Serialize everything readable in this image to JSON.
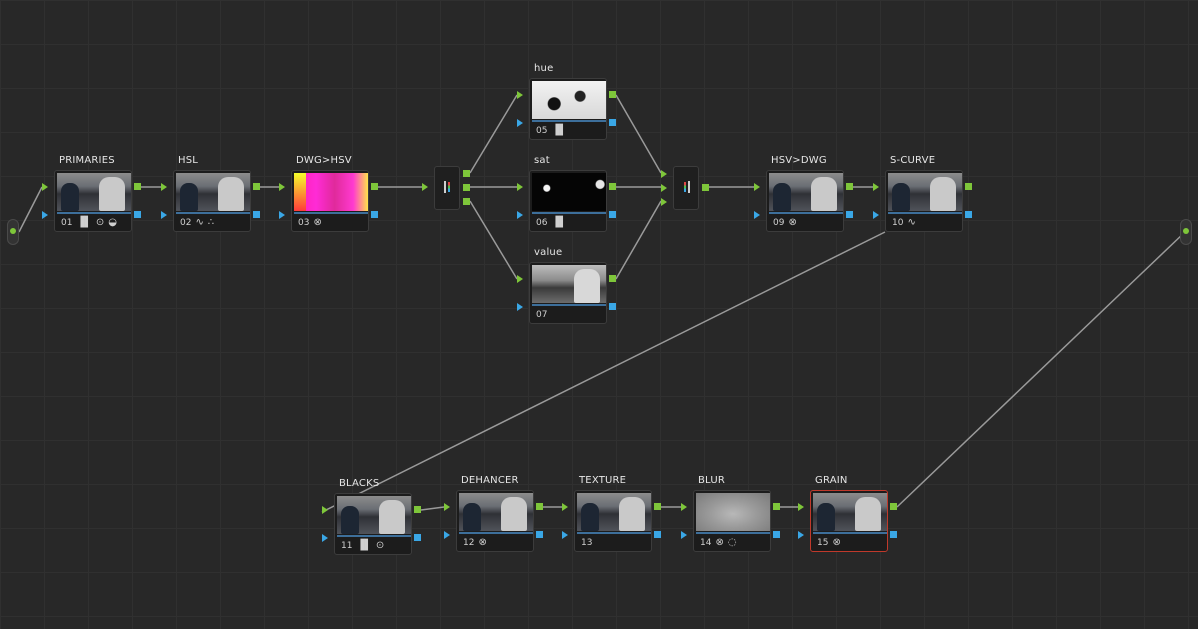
{
  "app": {
    "view": "Node Editor"
  },
  "nodes": [
    {
      "id": "n01",
      "label": "PRIMARIES",
      "number": "01",
      "icons": [
        "bars-icon",
        "circle-dot-icon",
        "curves-circle-icon"
      ],
      "thumb": "normal"
    },
    {
      "id": "n02",
      "label": "HSL",
      "number": "02",
      "icons": [
        "curve-icon",
        "qualifier-dots-icon"
      ],
      "thumb": "normal"
    },
    {
      "id": "n03",
      "label": "DWG>HSV",
      "number": "03",
      "icons": [
        "fx-icon"
      ],
      "thumb": "magenta"
    },
    {
      "id": "n05",
      "label": "hue",
      "number": "05",
      "icons": [
        "bars-icon"
      ],
      "thumb": "hue"
    },
    {
      "id": "n06",
      "label": "sat",
      "number": "06",
      "icons": [
        "bars-icon"
      ],
      "thumb": "sat"
    },
    {
      "id": "n07",
      "label": "value",
      "number": "07",
      "icons": [],
      "thumb": "value"
    },
    {
      "id": "n09",
      "label": "HSV>DWG",
      "number": "09",
      "icons": [
        "fx-icon"
      ],
      "thumb": "normal"
    },
    {
      "id": "n10",
      "label": "S-CURVE",
      "number": "10",
      "icons": [
        "curve-icon"
      ],
      "thumb": "normal"
    },
    {
      "id": "n11",
      "label": "BLACKS",
      "number": "11",
      "icons": [
        "bars-icon",
        "circle-dot-icon"
      ],
      "thumb": "normal"
    },
    {
      "id": "n12",
      "label": "DEHANCER",
      "number": "12",
      "icons": [
        "fx-icon"
      ],
      "thumb": "normal"
    },
    {
      "id": "n13",
      "label": "TEXTURE",
      "number": "13",
      "icons": [],
      "thumb": "normal"
    },
    {
      "id": "n14",
      "label": "BLUR",
      "number": "14",
      "icons": [
        "fx-icon",
        "dotted-circle-icon"
      ],
      "thumb": "blur"
    },
    {
      "id": "n15",
      "label": "GRAIN",
      "number": "15",
      "icons": [
        "fx-icon"
      ],
      "thumb": "normal",
      "selected": true
    }
  ],
  "colors": {
    "background": "#282828",
    "rgb_port": "#7ec63a",
    "key_port": "#3aa7e6",
    "wire": "#9a9a9a",
    "selected_border": "#c0392b"
  }
}
